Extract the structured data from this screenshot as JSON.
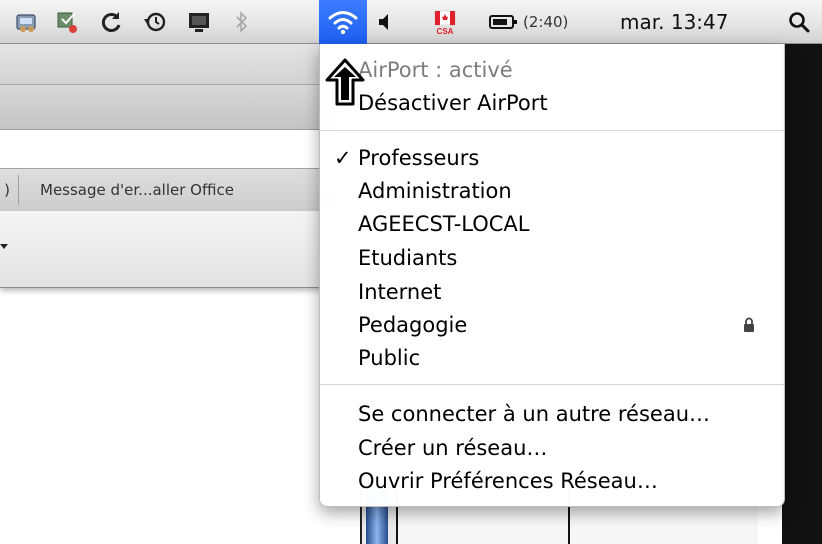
{
  "menubar": {
    "battery_time": "(2:40)",
    "datetime": "mar. 13:47",
    "input_source_label": "CSA",
    "icons": [
      "network-status-icon",
      "spellcheck-icon",
      "sync-icon",
      "time-machine-icon",
      "display-icon",
      "bluetooth-icon",
      "wifi-icon",
      "volume-icon",
      "canada-flag-icon",
      "battery-icon",
      "spotlight-search-icon"
    ]
  },
  "background": {
    "tab_paren": ")",
    "tab_title": "Message d'er...aller Office"
  },
  "airport_menu": {
    "status": "AirPort : activé",
    "toggle": "Désactiver AirPort",
    "networks": [
      {
        "name": "Professeurs",
        "selected": true,
        "locked": false
      },
      {
        "name": "Administration",
        "selected": false,
        "locked": false
      },
      {
        "name": "AGEECST-LOCAL",
        "selected": false,
        "locked": false
      },
      {
        "name": "Etudiants",
        "selected": false,
        "locked": false
      },
      {
        "name": "Internet",
        "selected": false,
        "locked": false
      },
      {
        "name": "Pedagogie",
        "selected": false,
        "locked": true
      },
      {
        "name": "Public",
        "selected": false,
        "locked": false
      }
    ],
    "checkmark": "✓",
    "actions": [
      "Se connecter à un autre réseau…",
      "Créer un réseau…",
      "Ouvrir Préférences Réseau…"
    ]
  },
  "colors": {
    "wifi_highlight": "#1d5ff0",
    "menubar": "#e5e5e5"
  }
}
